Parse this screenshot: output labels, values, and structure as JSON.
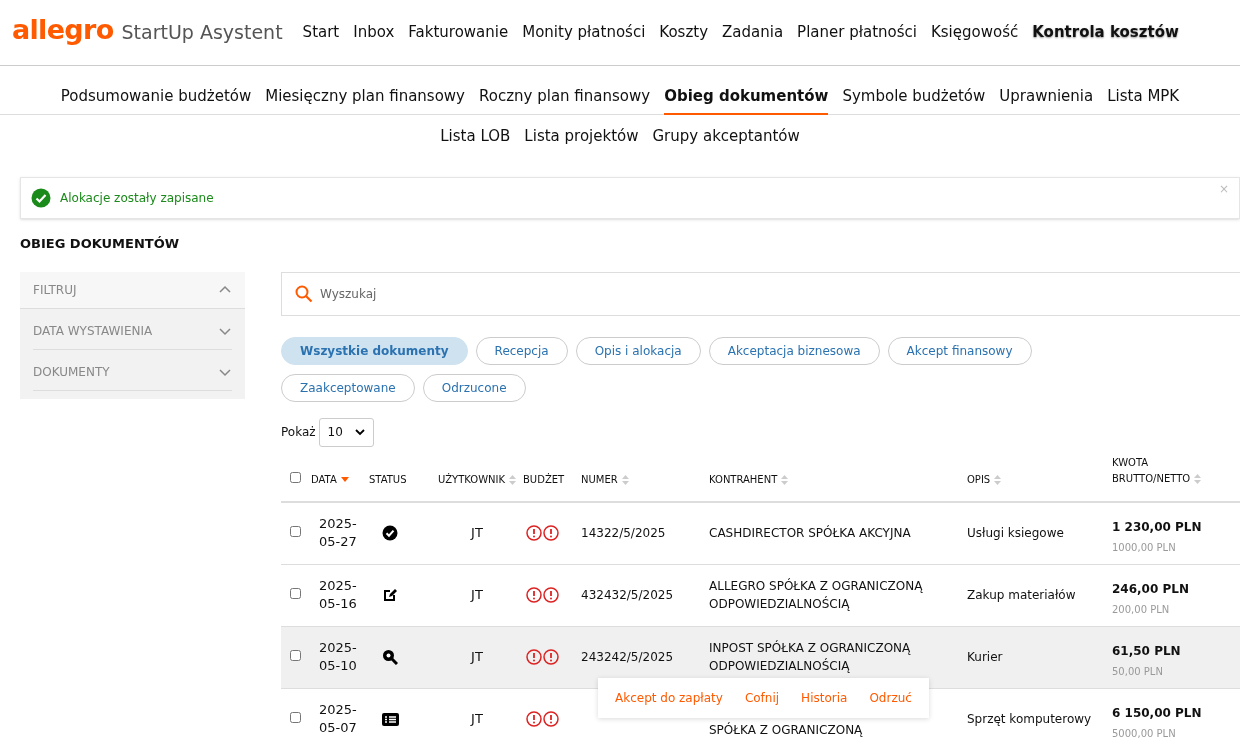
{
  "brand": {
    "logo": "allegro",
    "product": "StartUp Asystent"
  },
  "main_nav": [
    {
      "label": "Start",
      "selected": false
    },
    {
      "label": "Inbox",
      "selected": false
    },
    {
      "label": "Fakturowanie",
      "selected": false
    },
    {
      "label": "Monity płatności",
      "selected": false
    },
    {
      "label": "Koszty",
      "selected": false
    },
    {
      "label": "Zadania",
      "selected": false
    },
    {
      "label": "Planer płatności",
      "selected": false
    },
    {
      "label": "Księgowość",
      "selected": false
    },
    {
      "label": "Kontrola kosztów",
      "selected": true
    }
  ],
  "sub_nav": [
    [
      {
        "label": "Podsumowanie budżetów",
        "selected": false
      },
      {
        "label": "Miesięczny plan finansowy",
        "selected": false
      },
      {
        "label": "Roczny plan finansowy",
        "selected": false
      },
      {
        "label": "Obieg dokumentów",
        "selected": true
      },
      {
        "label": "Symbole budżetów",
        "selected": false
      },
      {
        "label": "Uprawnienia",
        "selected": false
      },
      {
        "label": "Lista MPK",
        "selected": false
      }
    ],
    [
      {
        "label": "Lista LOB",
        "selected": false
      },
      {
        "label": "Lista projektów",
        "selected": false
      },
      {
        "label": "Grupy akceptantów",
        "selected": false
      }
    ]
  ],
  "alert": {
    "message": "Alokacje zostały zapisane",
    "close": "×"
  },
  "page_title": "OBIEG DOKUMENTÓW",
  "filters": [
    {
      "label": "FILTRUJ",
      "expanded": true
    },
    {
      "label": "DATA WYSTAWIENIA",
      "expanded": false
    },
    {
      "label": "DOKUMENTY",
      "expanded": false
    }
  ],
  "search": {
    "placeholder": "Wyszukaj"
  },
  "chips": [
    {
      "label": "Wszystkie dokumenty",
      "selected": true
    },
    {
      "label": "Recepcja",
      "selected": false
    },
    {
      "label": "Opis i alokacja",
      "selected": false
    },
    {
      "label": "Akceptacja biznesowa",
      "selected": false
    },
    {
      "label": "Akcept finansowy",
      "selected": false
    },
    {
      "label": "Zaakceptowane",
      "selected": false
    },
    {
      "label": "Odrzucone",
      "selected": false
    }
  ],
  "page_size": {
    "label": "Pokaż",
    "value": "10"
  },
  "table": {
    "all_checked": false,
    "columns": [
      {
        "label": "DATA",
        "sorted": true
      },
      {
        "label": "STATUS",
        "sortable": false,
        "sorted": false
      },
      {
        "label": "UŻYTKOWNIK",
        "sortable": true,
        "sorted": false
      },
      {
        "label": "BUDŻET",
        "sortable": false,
        "sorted": false
      },
      {
        "label": "NUMER",
        "sortable": true,
        "sorted": false
      },
      {
        "label": "KONTRAHENT",
        "sortable": true,
        "sorted": false
      },
      {
        "label": "OPIS",
        "sortable": true,
        "sorted": false
      },
      {
        "label": "KWOTA BRUTTO/NETTO",
        "sortable": true,
        "sorted": false
      }
    ],
    "rows": [
      {
        "checked": false,
        "highlighted": false,
        "date": "2025-05-27",
        "kind": "check",
        "user": "JT",
        "number": "14322/5/2025",
        "contractor": "CASHDIRECTOR SPÓŁKA AKCYJNA",
        "description": "Usługi ksiegowe",
        "gross": "1 230,00 PLN",
        "net": "1000,00 PLN"
      },
      {
        "checked": false,
        "highlighted": false,
        "date": "2025-05-16",
        "kind": "edit",
        "user": "JT",
        "number": "432432/5/2025",
        "contractor": "ALLEGRO SPÓŁKA Z OGRANICZONĄ ODPOWIEDZIALNOŚCIĄ",
        "description": "Zakup materiałów",
        "gross": "246,00 PLN",
        "net": "200,00 PLN"
      },
      {
        "checked": false,
        "highlighted": true,
        "date": "2025-05-10",
        "kind": "search",
        "user": "JT",
        "number": "243242/5/2025",
        "contractor": "INPOST SPÓŁKA Z OGRANICZONĄ ODPOWIEDZIALNOŚCIĄ",
        "description": "Kurier",
        "gross": "61,50 PLN",
        "net": "50,00 PLN"
      },
      {
        "checked": false,
        "highlighted": false,
        "date": "2025-05-07",
        "kind": "list",
        "user": "JT",
        "contractor": "SPÓŁKA Z OGRANICZONĄ",
        "description": "Sprzęt komputerowy",
        "gross": "6 150,00 PLN",
        "net": "5000,00 PLN"
      }
    ]
  },
  "row_actions": [
    "Akcept do zapłaty",
    "Cofnij",
    "Historia",
    "Odrzuć"
  ]
}
